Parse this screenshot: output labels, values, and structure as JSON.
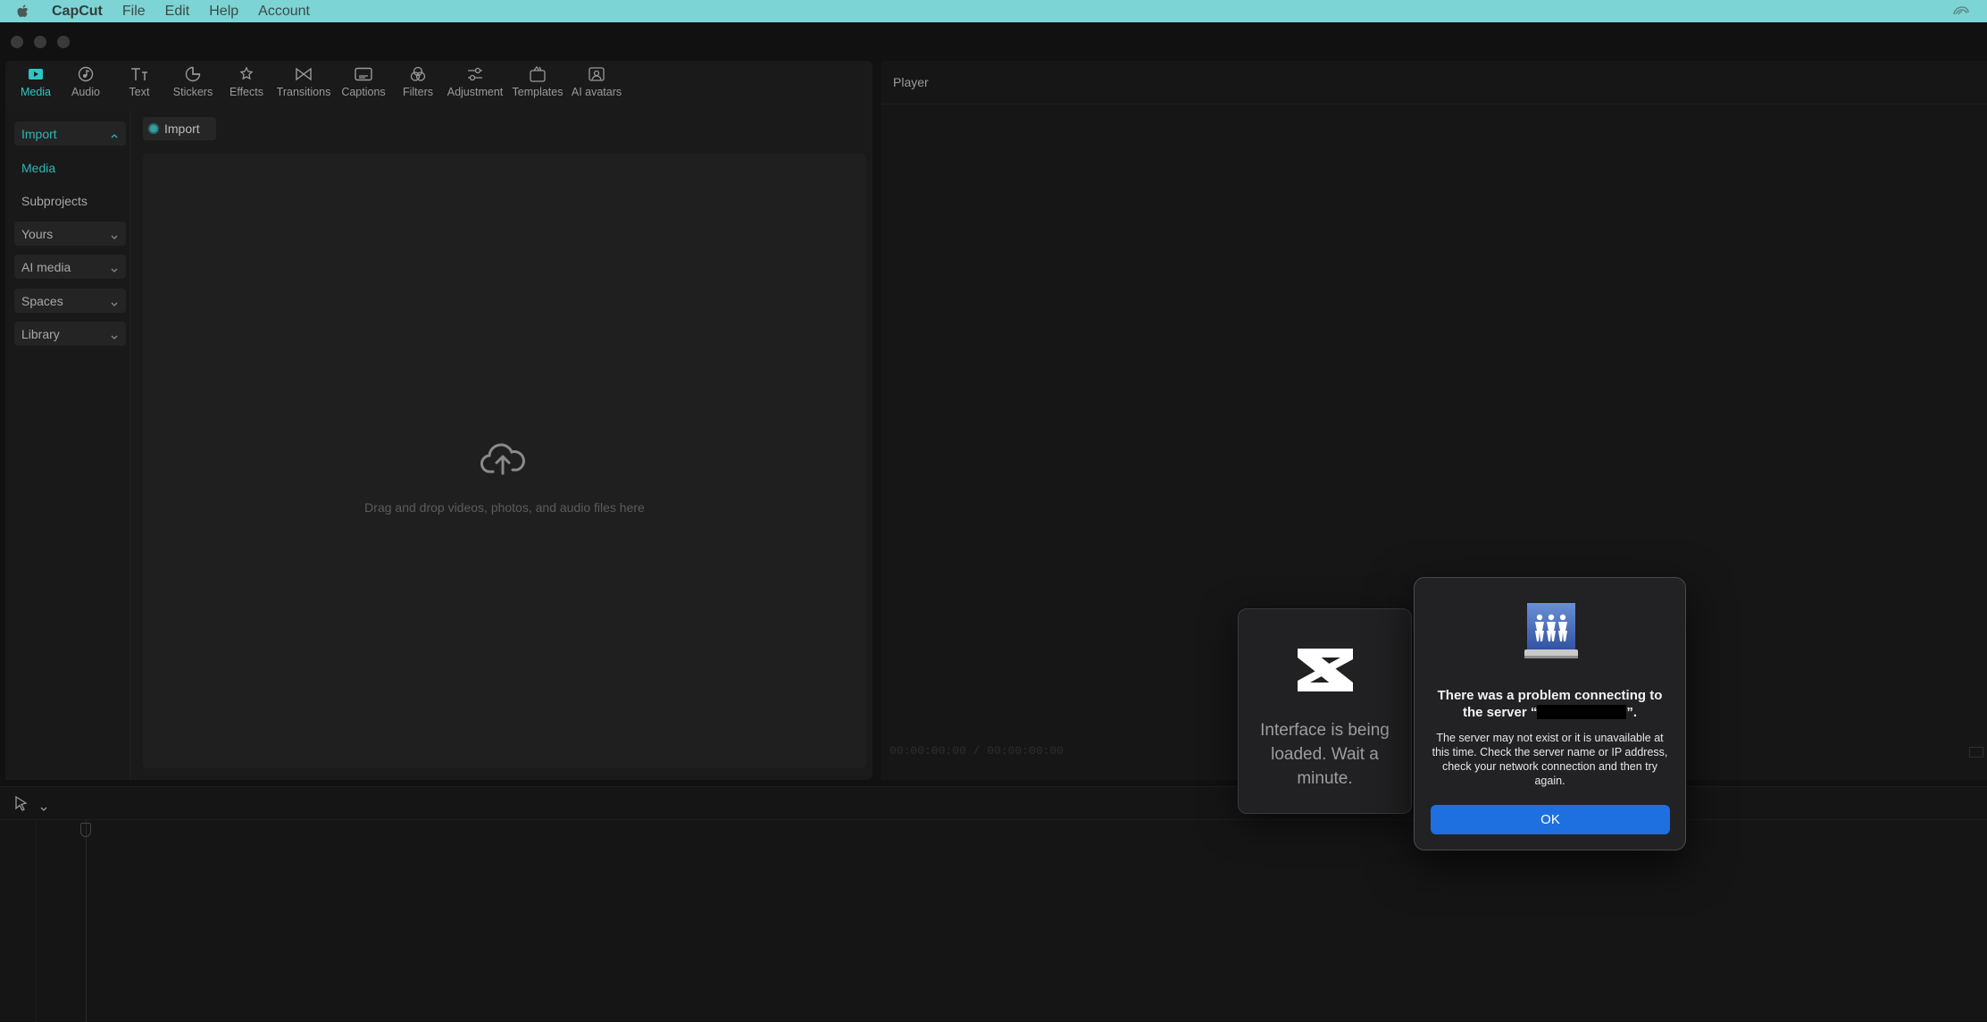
{
  "menubar": {
    "app_name": "CapCut",
    "items": [
      "File",
      "Edit",
      "Help",
      "Account"
    ]
  },
  "toolbar": {
    "tools": [
      {
        "label": "Media",
        "icon": "media-icon",
        "active": true
      },
      {
        "label": "Audio",
        "icon": "audio-icon"
      },
      {
        "label": "Text",
        "icon": "text-icon"
      },
      {
        "label": "Stickers",
        "icon": "stickers-icon"
      },
      {
        "label": "Effects",
        "icon": "effects-icon"
      },
      {
        "label": "Transitions",
        "icon": "transitions-icon"
      },
      {
        "label": "Captions",
        "icon": "captions-icon"
      },
      {
        "label": "Filters",
        "icon": "filters-icon"
      },
      {
        "label": "Adjustment",
        "icon": "adjustment-icon"
      },
      {
        "label": "Templates",
        "icon": "templates-icon"
      },
      {
        "label": "AI avatars",
        "icon": "ai-avatars-icon"
      }
    ]
  },
  "sidebar": {
    "items": [
      {
        "label": "Import"
      },
      {
        "label": "Media"
      },
      {
        "label": "Subprojects"
      },
      {
        "label": "Yours"
      },
      {
        "label": "AI media"
      },
      {
        "label": "Spaces"
      },
      {
        "label": "Library"
      }
    ]
  },
  "media": {
    "import_label": "Import",
    "drop_hint": "Drag and drop videos, photos, and audio files here"
  },
  "player": {
    "title": "Player",
    "timecode": "00:00:00:00 / 00:00:00:00"
  },
  "loading": {
    "message": "Interface is being loaded. Wait a minute."
  },
  "alert": {
    "headline_before": "There was a problem connecting to the server “",
    "headline_after": "”.",
    "body": "The server may not exist or it is unavailable at this time. Check the server name or IP address, check your network connection and then try again.",
    "ok_label": "OK"
  },
  "colors": {
    "menubar": "#7dd4d4",
    "accent": "#2ec5c5",
    "ok_button": "#1e6fe0"
  }
}
